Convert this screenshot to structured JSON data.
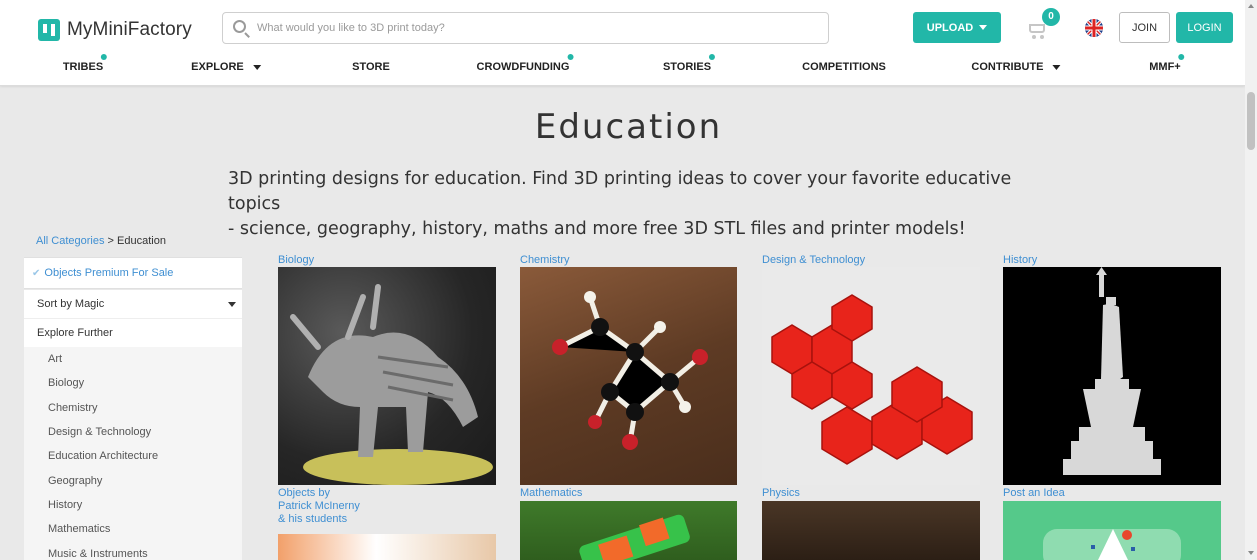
{
  "header": {
    "logo_text": "MyMiniFactory",
    "search_placeholder": "What would you like to 3D print today?",
    "upload_label": "UPLOAD",
    "cart_count": "0",
    "join_label": "JOIN",
    "login_label": "LOGIN",
    "accent_color": "#22b7a8"
  },
  "nav": {
    "items": [
      {
        "label": "TRIBES",
        "dot": true
      },
      {
        "label": "EXPLORE",
        "dropdown": true
      },
      {
        "label": "STORE"
      },
      {
        "label": "CROWDFUNDING",
        "dot": true
      },
      {
        "label": "STORIES",
        "dot": true
      },
      {
        "label": "COMPETITIONS"
      },
      {
        "label": "CONTRIBUTE",
        "dropdown": true
      },
      {
        "label": "MMF+",
        "dot": true
      }
    ]
  },
  "page": {
    "title": "Education",
    "description_line1": "3D printing designs for education. Find 3D printing ideas to cover your favorite educative topics",
    "description_line2": "- science, geography, history, maths and more free 3D STL files and printer models!"
  },
  "breadcrumb": {
    "root": "All Categories",
    "separator": " > ",
    "current": "Education"
  },
  "sidebar": {
    "premium_label": "Objects Premium For Sale",
    "sort_label": "Sort by Magic",
    "explore_label": "Explore Further",
    "categories": [
      "Art",
      "Biology",
      "Chemistry",
      "Design & Technology",
      "Education Architecture",
      "Geography",
      "History",
      "Mathematics",
      "Music & Instruments"
    ]
  },
  "grid": {
    "row1": [
      "Biology",
      "Chemistry",
      "Design & Technology",
      "History"
    ],
    "row2": [
      "Objects by",
      "Patrick McInerny",
      "& his students",
      "Mathematics",
      "Physics",
      "Post an Idea"
    ]
  }
}
